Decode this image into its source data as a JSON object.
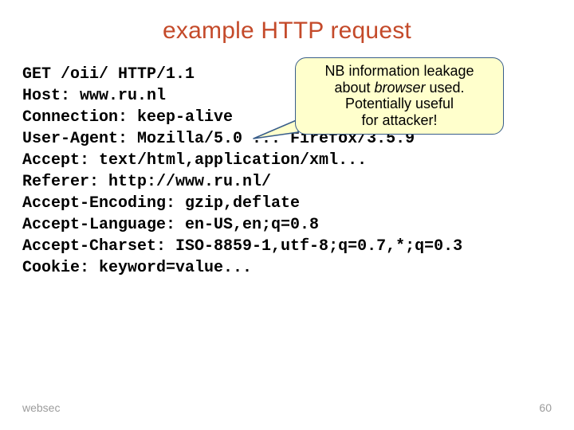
{
  "title": "example HTTP request",
  "code_lines": [
    "GET /oii/ HTTP/1.1",
    "Host: www.ru.nl",
    "Connection: keep-alive",
    "User-Agent: Mozilla/5.0 ... Firefox/3.5.9",
    "Accept: text/html,application/xml...",
    "Referer: http://www.ru.nl/",
    "Accept-Encoding: gzip,deflate",
    "Accept-Language: en-US,en;q=0.8",
    "Accept-Charset: ISO-8859-1,utf-8;q=0.7,*;q=0.3",
    "Cookie: keyword=value..."
  ],
  "callout": {
    "l1": "NB information leakage",
    "l2a": "about ",
    "l2b": "browser",
    "l2c": " used.",
    "l3": "Potentially useful",
    "l4": "for attacker!"
  },
  "footer": {
    "left": "websec",
    "right": "60"
  }
}
